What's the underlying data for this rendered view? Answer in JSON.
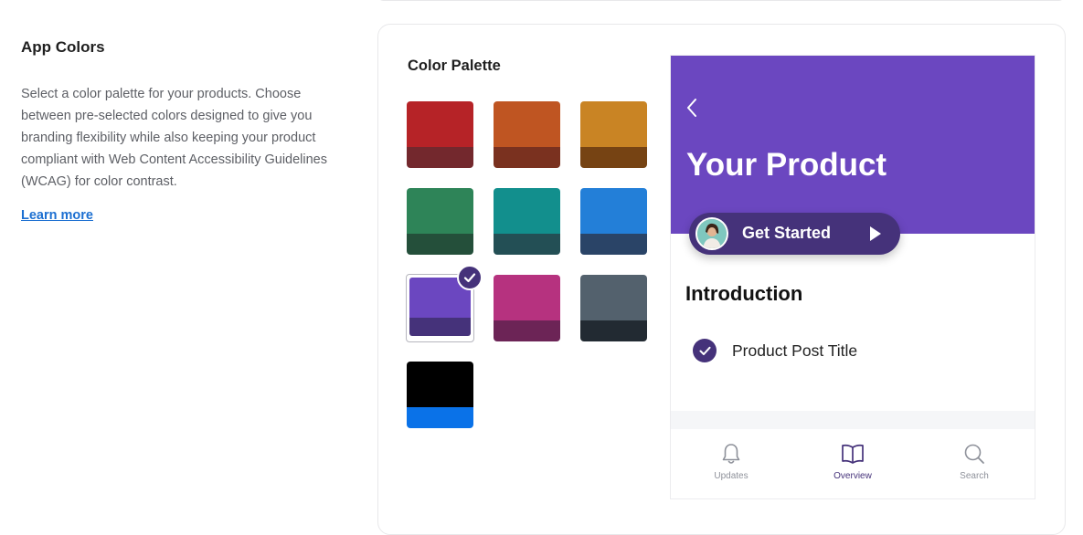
{
  "settings": {
    "title": "App Colors",
    "description": "Select a color palette for your products. Choose between pre-selected colors designed to give you branding flexibility while also keeping your product compliant with Web Content Accessibility Guidelines (WCAG) for color contrast.",
    "learn_more": "Learn more"
  },
  "palette": {
    "title": "Color Palette",
    "selected": "purple",
    "swatches": [
      {
        "name": "red",
        "primary": "#b62327",
        "secondary": "#73282d"
      },
      {
        "name": "orange",
        "primary": "#bf5522",
        "secondary": "#7a311f"
      },
      {
        "name": "amber",
        "primary": "#c98424",
        "secondary": "#764313"
      },
      {
        "name": "green",
        "primary": "#2e8458",
        "secondary": "#244f3a"
      },
      {
        "name": "teal",
        "primary": "#128f8d",
        "secondary": "#234f55"
      },
      {
        "name": "blue",
        "primary": "#237fd8",
        "secondary": "#2a4467"
      },
      {
        "name": "purple",
        "primary": "#6b47c0",
        "secondary": "#45327a"
      },
      {
        "name": "pink",
        "primary": "#b6327f",
        "secondary": "#6c2456"
      },
      {
        "name": "slate",
        "primary": "#53616d",
        "secondary": "#222a32"
      },
      {
        "name": "black",
        "primary": "#000000",
        "secondary": "#0a72e8"
      }
    ]
  },
  "preview": {
    "header_color": "#6b47c0",
    "accent_color": "#45327a",
    "product_title": "Your Product",
    "cta_label": "Get Started",
    "section_title": "Introduction",
    "post_title": "Product Post Title",
    "tabs": [
      {
        "label": "Updates",
        "icon": "bell-icon",
        "active": false
      },
      {
        "label": "Overview",
        "icon": "book-icon",
        "active": true
      },
      {
        "label": "Search",
        "icon": "search-icon",
        "active": false
      }
    ]
  }
}
